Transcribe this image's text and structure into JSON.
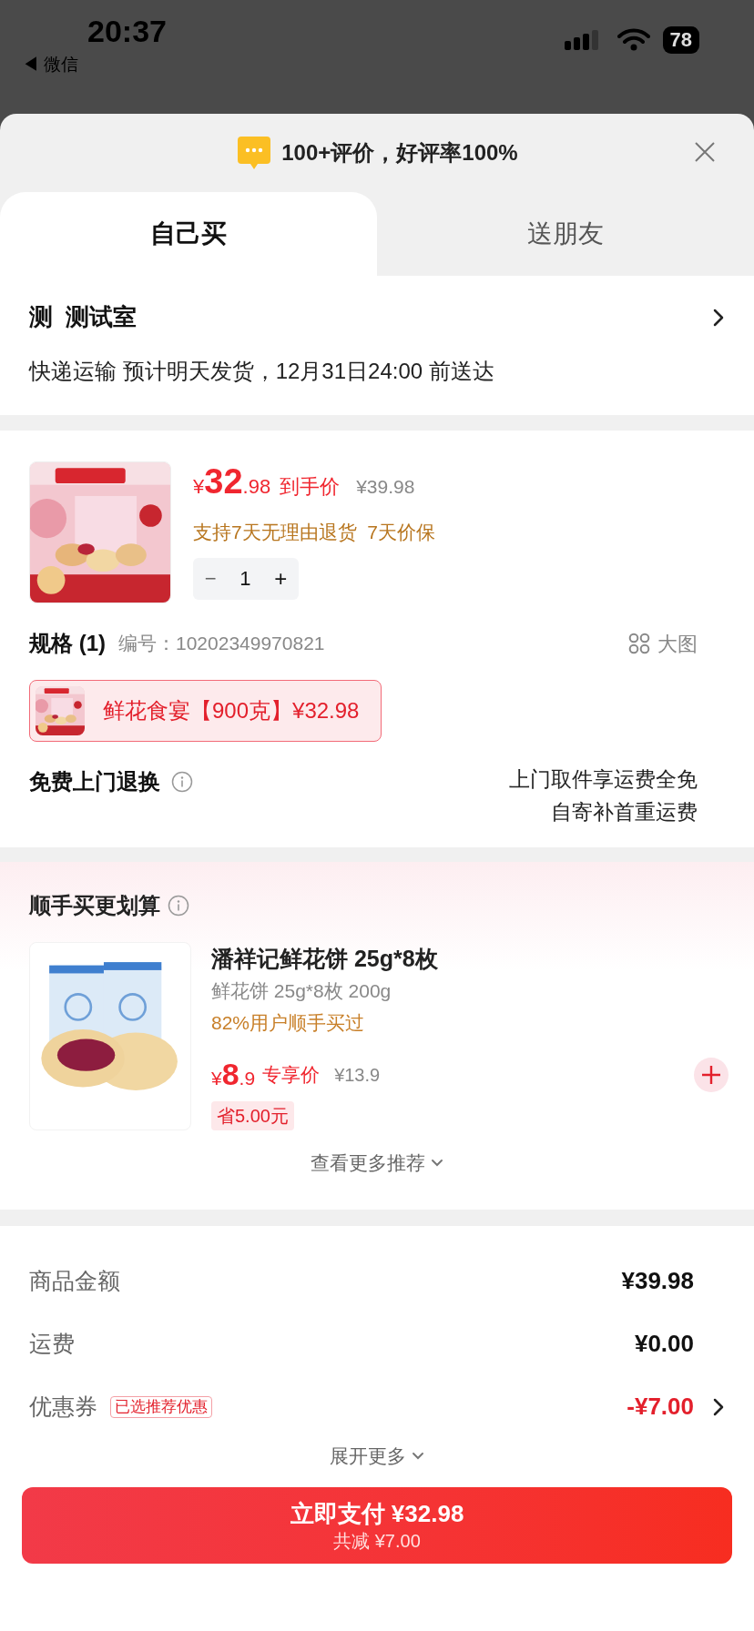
{
  "status_bar": {
    "time": "20:37",
    "back_app": "◀ 微信",
    "battery": "78"
  },
  "review_banner": {
    "text": "100+评价，好评率100%"
  },
  "tabs": [
    {
      "label": "自己买",
      "selected": true
    },
    {
      "label": "送朋友",
      "selected": false
    }
  ],
  "address": {
    "name": "测  测试室",
    "delivery": "快递运输 预计明天发货，12月31日24:00 前送达"
  },
  "product": {
    "currency": "¥",
    "price_int": "32",
    "price_dec": ".98",
    "price_label": "到手价",
    "original_price": "¥39.98",
    "guarantees": "支持7天无理由退货  7天价保",
    "quantity": "1",
    "minus": "−",
    "plus": "+",
    "spec_label": "规格 (1)",
    "spec_number": "编号：10202349970821",
    "big_image": "大图",
    "option": {
      "label": "鲜花食宴【900克】¥32.98",
      "selected": true
    },
    "return_service": "免费上门退换",
    "return_notes": [
      "上门取件享运费全免",
      "自寄补首重运费"
    ]
  },
  "addon": {
    "title": "顺手买更划算",
    "name": "潘祥记鲜花饼 25g*8枚",
    "variant": "鲜花饼 25g*8枚 200g",
    "social": "82%用户顺手买过",
    "currency": "¥",
    "price_int": "8",
    "price_dec": ".9",
    "price_label": "专享价",
    "original_price": "¥13.9",
    "saving": "省5.00元",
    "more": "查看更多推荐"
  },
  "summary": {
    "rows": [
      {
        "kind": "plain",
        "label": "商品金额",
        "value": "¥39.98"
      },
      {
        "kind": "plain",
        "label": "运费",
        "value": "¥0.00"
      },
      {
        "kind": "discount",
        "label": "优惠券",
        "tag": "已选推荐优惠",
        "value": "-¥7.00"
      }
    ],
    "expand": "展开更多"
  },
  "pay_button": {
    "label": "立即支付 ¥32.98",
    "sub": "共减 ¥7.00"
  }
}
